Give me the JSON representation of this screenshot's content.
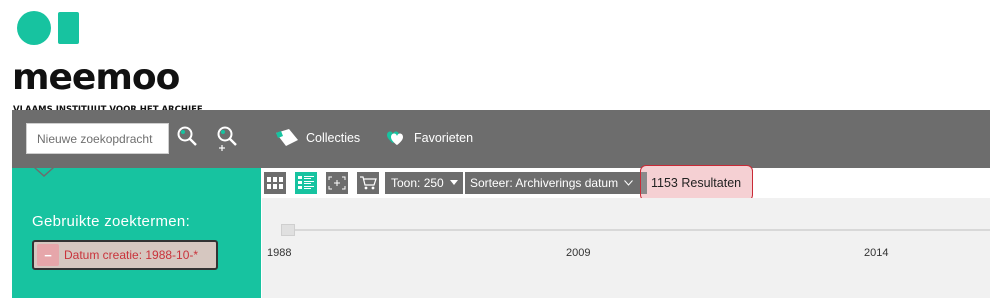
{
  "brand": {
    "name": "meemoo",
    "tagline": "VLAAMS INSTITUUT VOOR HET ARCHIEF",
    "color_teal": "#17c3a0",
    "color_dark": "#111111"
  },
  "topbar": {
    "search_placeholder": "Nieuwe zoekopdracht",
    "search_icon": "magnifier-icon",
    "advanced_search_icon": "magnifier-plus-icon",
    "nav": [
      {
        "label": "Collecties",
        "icon": "folder-icon"
      },
      {
        "label": "Favorieten",
        "icon": "heart-icon"
      }
    ],
    "background": "#6d6d6d"
  },
  "sidebar": {
    "heading": "Gebruikte zoektermen:",
    "terms": [
      {
        "label": "Datum creatie: 1988-10-*",
        "remove_icon": "minus-icon"
      }
    ]
  },
  "toolbar": {
    "view_buttons": [
      {
        "name": "grid-view",
        "icon": "grid-icon",
        "active": false
      },
      {
        "name": "list-view",
        "icon": "list-icon",
        "active": true
      },
      {
        "name": "expand-view",
        "icon": "expand-icon",
        "active": false
      },
      {
        "name": "basket",
        "icon": "cart-icon",
        "active": false
      }
    ],
    "page_size_label": "Toon: 250",
    "sort_label": "Sorteer: Archiverings datum",
    "results_label": "1153 Resultaten"
  },
  "timeline": {
    "ticks": [
      "1988",
      "2009",
      "2014"
    ]
  }
}
